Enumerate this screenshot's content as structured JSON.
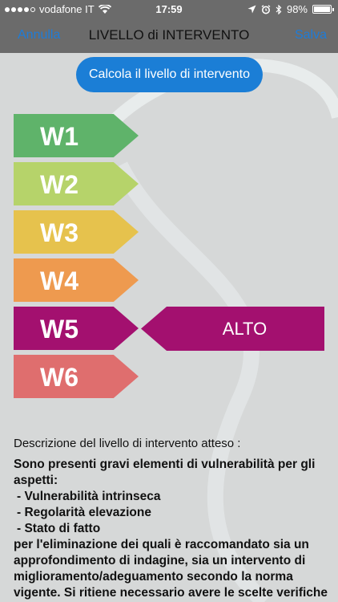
{
  "status_bar": {
    "carrier": "vodafone IT",
    "time": "17:59",
    "battery_percent": "98%",
    "battery_level": 0.98
  },
  "nav": {
    "cancel_label": "Annulla",
    "title": "LIVELLO di INTERVENTO",
    "save_label": "Salva"
  },
  "calc_button": {
    "label": "Calcola il livello di intervento"
  },
  "levels": [
    {
      "label": "W1",
      "color": "#5fb36a"
    },
    {
      "label": "W2",
      "color": "#b6d36a"
    },
    {
      "label": "W3",
      "color": "#e6c24d"
    },
    {
      "label": "W4",
      "color": "#ee9a4f"
    },
    {
      "label": "W5",
      "color": "#a3106f"
    },
    {
      "label": "W6",
      "color": "#df6e6e"
    }
  ],
  "selected_level": {
    "label": "ALTO",
    "color": "#a3106f"
  },
  "description": {
    "heading": "Descrizione del livello di intervento atteso :",
    "intro": "Sono presenti gravi elementi di vulnerabilità per gli aspetti:",
    "items": [
      "- Vulnerabilità intrinseca",
      "- Regolarità elevazione",
      "- Stato di fatto"
    ],
    "body": "per l'eliminazione dei quali è raccomandato sia un approfondimento di indagine, sia un intervento di miglioramento/adeguamento secondo la norma vigente.  Si ritiene necessario avere le scelte verifiche di vulnerabilità dell..."
  }
}
